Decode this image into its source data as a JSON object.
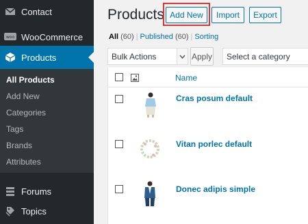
{
  "sidebar": {
    "items": [
      {
        "label": "Contact",
        "icon": "mail-icon"
      },
      {
        "label": "WooCommerce",
        "icon": "woocommerce-icon"
      },
      {
        "label": "Products",
        "icon": "products-icon"
      },
      {
        "label": "Forums",
        "icon": "forums-icon"
      },
      {
        "label": "Topics",
        "icon": "topics-icon"
      }
    ],
    "submenu": [
      "All Products",
      "Add New",
      "Categories",
      "Tags",
      "Brands",
      "Attributes"
    ]
  },
  "header": {
    "title": "Products",
    "add_new": "Add New",
    "import": "Import",
    "export": "Export"
  },
  "views": {
    "all": "All",
    "all_count": "(60)",
    "published": "Published",
    "published_count": "(60)",
    "sorting": "Sorting"
  },
  "filters": {
    "bulk_actions": "Bulk Actions",
    "apply": "Apply",
    "category": "Select a category"
  },
  "table": {
    "column_name": "Name",
    "rows": [
      {
        "name": "Cras posum default"
      },
      {
        "name": "Vitan porlec default"
      },
      {
        "name": "Donec adipis simple"
      }
    ]
  },
  "colors": {
    "sidebar_bg": "#23282d",
    "submenu_bg": "#32373c",
    "accent": "#0073aa",
    "highlight": "#d63638"
  }
}
